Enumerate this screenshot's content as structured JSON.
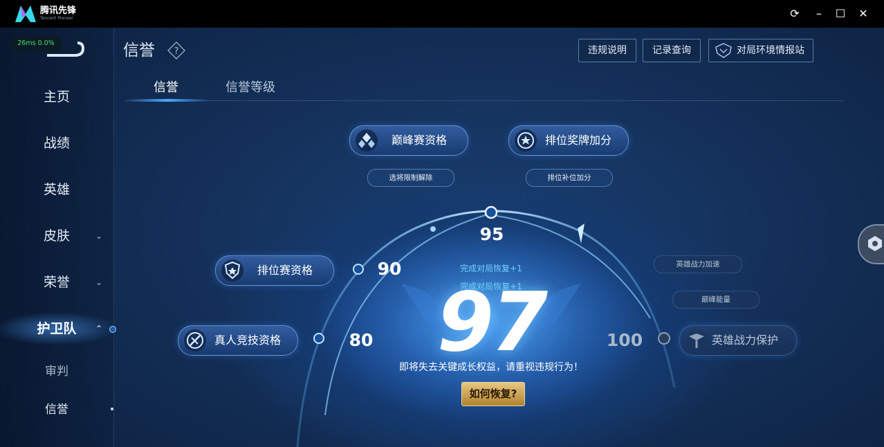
{
  "app": {
    "name": "腾讯先锋",
    "subtitle": "Tencent Pioneer"
  },
  "perf": {
    "latency": "26ms",
    "loss": "0.0%"
  },
  "header": {
    "title": "信誉",
    "help_icon": "question-diamond-icon",
    "buttons": [
      {
        "label": "违规说明"
      },
      {
        "label": "记录查询"
      },
      {
        "label": "对局环境情报站",
        "icon": "shield-emblem-icon"
      }
    ]
  },
  "sidebar": {
    "items": [
      {
        "label": "主页"
      },
      {
        "label": "战绩"
      },
      {
        "label": "英雄"
      },
      {
        "label": "皮肤",
        "chevron": "down"
      },
      {
        "label": "荣誉",
        "chevron": "down"
      },
      {
        "label": "护卫队",
        "chevron": "up",
        "active": true
      },
      {
        "label": "审判"
      },
      {
        "label": "信誉"
      }
    ]
  },
  "tabs": [
    {
      "label": "信誉",
      "active": true
    },
    {
      "label": "信誉等级",
      "active": false
    }
  ],
  "rewards": {
    "peak": {
      "label": "巅峰赛资格",
      "sub": "选将限制解除",
      "icon": "peak-crystal-icon"
    },
    "rank_bonus": {
      "label": "排位奖牌加分",
      "sub": "排位补位加分",
      "icon": "medal-star-icon"
    },
    "rank": {
      "label": "排位赛资格",
      "icon": "rank-emblem-icon"
    },
    "real_pvp": {
      "label": "真人竞技资格",
      "icon": "sword-badge-icon"
    },
    "hero_protect": {
      "label": "英雄战力保护",
      "icon": "hero-crest-icon"
    },
    "hero_boost": {
      "label": "英雄战力加速"
    },
    "peak_energy": {
      "label": "巅峰能量"
    }
  },
  "thresholds": {
    "t80": "80",
    "t90": "90",
    "t95": "95",
    "t100": "100"
  },
  "score": {
    "value": "97",
    "recover_1": "完成对局恢复+1",
    "recover_2": "完成对局恢复+1",
    "warning": "即将失去关键成长权益，请重视违规行为！",
    "how_button": "如何恢复?"
  },
  "colors": {
    "accent": "#4aa8ff",
    "gold": "#d4a84e",
    "perf_green": "#44e07a"
  }
}
